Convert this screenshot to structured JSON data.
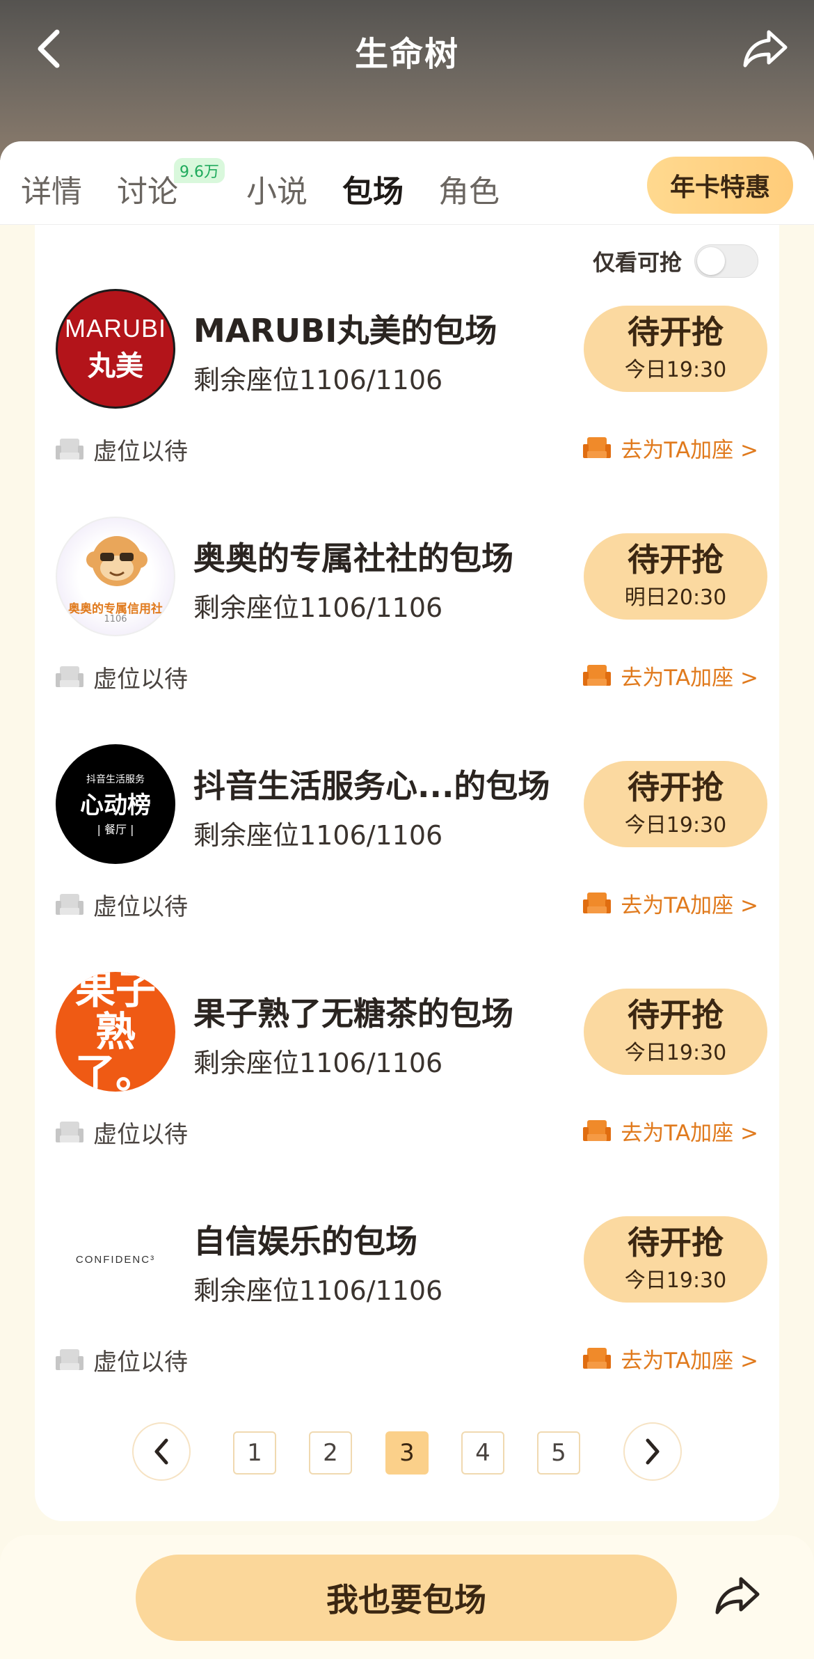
{
  "header": {
    "title": "生命树"
  },
  "tabs": [
    {
      "label": "详情"
    },
    {
      "label": "讨论",
      "badge": "9.6万"
    },
    {
      "label": "小说"
    },
    {
      "label": "包场",
      "active": true
    },
    {
      "label": "角色"
    }
  ],
  "vip_button": "年卡特惠",
  "filter": {
    "label": "仅看可抢",
    "on": false
  },
  "rows": [
    {
      "avatar": "marubi",
      "title": "MARUBI丸美的包场",
      "seats": "剩余座位1106/1106",
      "button": "待开抢",
      "time": "今日19:30",
      "waiting": "虚位以待",
      "add": "去为TA加座 >"
    },
    {
      "avatar": "aoao",
      "title": "奥奥的专属社社的包场",
      "seats": "剩余座位1106/1106",
      "button": "待开抢",
      "time": "明日20:30",
      "waiting": "虚位以待",
      "add": "去为TA加座 >"
    },
    {
      "avatar": "douyin",
      "title": "抖音生活服务心...的包场",
      "seats": "剩余座位1106/1106",
      "button": "待开抢",
      "time": "今日19:30",
      "waiting": "虚位以待",
      "add": "去为TA加座 >"
    },
    {
      "avatar": "guozi",
      "title": "果子熟了无糖茶的包场",
      "seats": "剩余座位1106/1106",
      "button": "待开抢",
      "time": "今日19:30",
      "waiting": "虚位以待",
      "add": "去为TA加座 >"
    },
    {
      "avatar": "confidence",
      "title": "自信娱乐的包场",
      "seats": "剩余座位1106/1106",
      "button": "待开抢",
      "time": "今日19:30",
      "waiting": "虚位以待",
      "add": "去为TA加座 >"
    }
  ],
  "avatars": {
    "marubi": {
      "line1": "MARUBI",
      "line2": "丸美"
    },
    "aoao": {
      "caption": "奥奥的专属信用社",
      "number": "1106"
    },
    "douyin": {
      "small": "抖音生活服务",
      "big": "心动榜",
      "sub": "| 餐厅 |"
    },
    "guozi": {
      "line1": "果子",
      "line2": "熟了。"
    },
    "confidence": {
      "text": "CONFIDENC³"
    }
  },
  "pagination": {
    "pages": [
      "1",
      "2",
      "3",
      "4",
      "5"
    ],
    "current": "3"
  },
  "bottom": {
    "cta": "我也要包场"
  },
  "colors": {
    "accent": "#fbd79a",
    "orange": "#e07a1d",
    "badge_green": "#1faa5c"
  }
}
